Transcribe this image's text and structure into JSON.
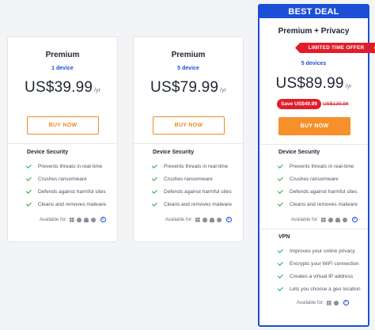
{
  "colors": {
    "accent": "#1d4fd6",
    "cta": "#f6902a",
    "sale": "#e11d2a",
    "check": "#2fa84f"
  },
  "plans": [
    {
      "name": "Premium",
      "devices": "1 device",
      "price": "US$39.99",
      "period": "/yr",
      "cta": "BUY NOW",
      "section": "Device Security",
      "features": [
        "Prevents threats in real-time",
        "Crushes ransomware",
        "Defends against harmful sites",
        "Cleans and removes malware"
      ],
      "available_for": "Available for:",
      "platform_icons": [
        "windows-icon",
        "apple-icon",
        "android-icon",
        "chrome-icon"
      ]
    },
    {
      "name": "Premium",
      "devices": "5 device",
      "price": "US$79.99",
      "period": "/yr",
      "cta": "BUY NOW",
      "section": "Device Security",
      "features": [
        "Prevents threats in real-time",
        "Crushes ransomware",
        "Defends against harmful sites",
        "Cleans and removes malware"
      ],
      "available_for": "Available for:",
      "platform_icons": [
        "windows-icon",
        "apple-icon",
        "android-icon",
        "chrome-icon"
      ]
    },
    {
      "banner": "BEST DEAL",
      "name": "Premium + Privacy",
      "ribbon": "LIMITED TIME OFFER",
      "devices": "5 devices",
      "price": "US$89.99",
      "period": "/yr",
      "save_badge": "Save US$49.99",
      "original_price": "US$139.98",
      "cta": "BUY NOW",
      "section": "Device Security",
      "features": [
        "Prevents threats in real-time",
        "Crushes ransomware",
        "Defends against harmful sites",
        "Cleans and removes malware"
      ],
      "available_for": "Available for:",
      "platform_icons": [
        "windows-icon",
        "apple-icon",
        "android-icon",
        "chrome-icon"
      ],
      "section2": "VPN",
      "features2": [
        "Improves your online privacy",
        "Encrypts your WiFi connection",
        "Creates a virtual IP address",
        "Lets you choose a geo location"
      ],
      "available_for2": "Available for:",
      "platform_icons2": [
        "windows-icon",
        "apple-icon"
      ]
    }
  ]
}
